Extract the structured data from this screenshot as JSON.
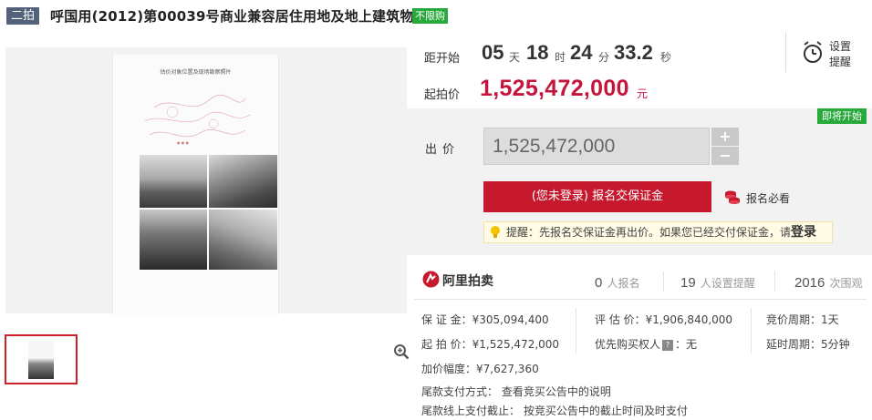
{
  "header": {
    "round_badge": "二拍",
    "title": "呼国用(2012)第00039号商业兼容居住用地及地上建筑物",
    "purchase_badge": "不限购"
  },
  "gallery": {
    "doc_title": "估价对象位置及现场勘察照片",
    "zoom_icon": "zoom-in-icon"
  },
  "countdown": {
    "label": "距开始",
    "days": "05",
    "days_unit": "天",
    "hours": "18",
    "hours_unit": "时",
    "minutes": "24",
    "minutes_unit": "分",
    "seconds": "33.2",
    "seconds_unit": "秒",
    "remind_line1": "设置",
    "remind_line2": "提醒",
    "start_price_label": "起拍价",
    "start_price": "1,525,472,000",
    "start_price_unit": "元"
  },
  "bid": {
    "status_badge": "即将开始",
    "label": "出价",
    "value": "1,525,472,000",
    "plus": "+",
    "minus": "−",
    "register_button": "(您未登录) 报名交保证金",
    "must_read": "报名必看",
    "notice_text": "提醒：先报名交保证金再出价。如果您已经交付保证金，请",
    "notice_link": "登录"
  },
  "info": {
    "brand": "阿里拍卖",
    "stats": [
      {
        "num": "0",
        "unit": "人报名"
      },
      {
        "num": "19",
        "unit": "人设置提醒"
      },
      {
        "num": "2016",
        "unit": "次围观"
      }
    ],
    "deposit": "保 证 金：¥305,094,400",
    "appraisal": "评 估 价：¥1,906,840,000",
    "bid_cycle": "竞价周期：1天",
    "start_price": "起 拍 价：¥1,525,472,000",
    "priority_label": "优先购买权人",
    "priority_value": "：无",
    "delay_cycle": "延时周期：5分钟",
    "increment": "加价幅度：¥7,627,360",
    "balance_method": "尾款支付方式：  查看竞买公告中的说明",
    "balance_deadline": "尾款线上支付截止：  按竞买公告中的截止时间及时支付"
  },
  "colors": {
    "accent_red": "#c6192e",
    "price_red": "#c5153c",
    "badge_green": "#27a93b",
    "badge_slate": "#53627a"
  }
}
